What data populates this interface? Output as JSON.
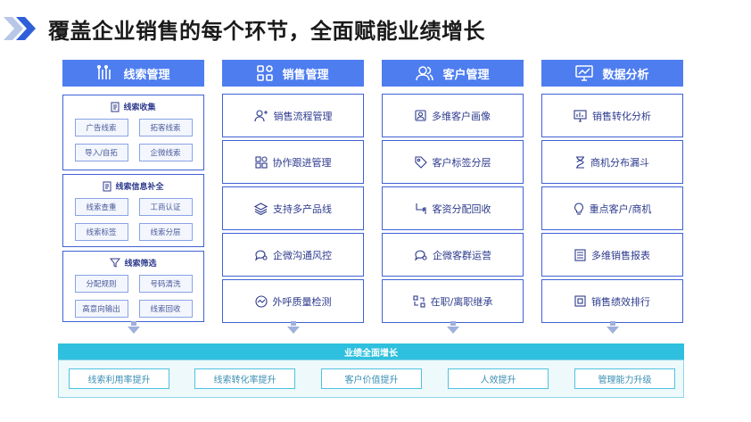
{
  "title": "覆盖企业销售的每个环节，全面赋能业绩增长",
  "columns": [
    {
      "header": "线索管理",
      "icon": "bars-icon",
      "groups": [
        {
          "title": "线索收集",
          "icon": "document-icon",
          "tags": [
            "广告线索",
            "拓客线索",
            "导入/自拓",
            "企微线索"
          ]
        },
        {
          "title": "线索信息补全",
          "icon": "document-icon",
          "tags": [
            "线索查重",
            "工商认证",
            "线索标签",
            "线索分层"
          ]
        },
        {
          "title": "线索筛选",
          "icon": "filter-icon",
          "tags": [
            "分配规则",
            "号码清洗",
            "高意向输出",
            "线索回收"
          ]
        }
      ]
    },
    {
      "header": "销售管理",
      "icon": "grid-icon",
      "items": [
        {
          "label": "销售流程管理",
          "icon": "user-flow-icon"
        },
        {
          "label": "协作跟进管理",
          "icon": "grid-icon"
        },
        {
          "label": "支持多产品线",
          "icon": "layers-icon"
        },
        {
          "label": "企微沟通风控",
          "icon": "chat-icon"
        },
        {
          "label": "外呼质量检测",
          "icon": "gauge-icon"
        }
      ]
    },
    {
      "header": "客户管理",
      "icon": "users-icon",
      "items": [
        {
          "label": "多维客户画像",
          "icon": "portrait-icon"
        },
        {
          "label": "客户标签分层",
          "icon": "tag-icon"
        },
        {
          "label": "客资分配回收",
          "icon": "cycle-icon"
        },
        {
          "label": "企微客群运营",
          "icon": "chat-icon"
        },
        {
          "label": "在职/离职继承",
          "icon": "transfer-icon"
        }
      ]
    },
    {
      "header": "数据分析",
      "icon": "monitor-chart-icon",
      "items": [
        {
          "label": "销售转化分析",
          "icon": "chart-icon"
        },
        {
          "label": "商机分布漏斗",
          "icon": "hourglass-icon"
        },
        {
          "label": "重点客户/商机",
          "icon": "bulb-icon"
        },
        {
          "label": "多维销售报表",
          "icon": "report-icon"
        },
        {
          "label": "销售绩效排行",
          "icon": "rank-icon"
        }
      ]
    }
  ],
  "growth": {
    "title": "业绩全面增长",
    "items": [
      "线索利用率提升",
      "线索转化率提升",
      "客户价值提升",
      "人效提升",
      "管理能力升级"
    ]
  },
  "colors": {
    "accent": "#4e7df0",
    "border": "#3f62d6",
    "growth": "#2ec0de"
  }
}
